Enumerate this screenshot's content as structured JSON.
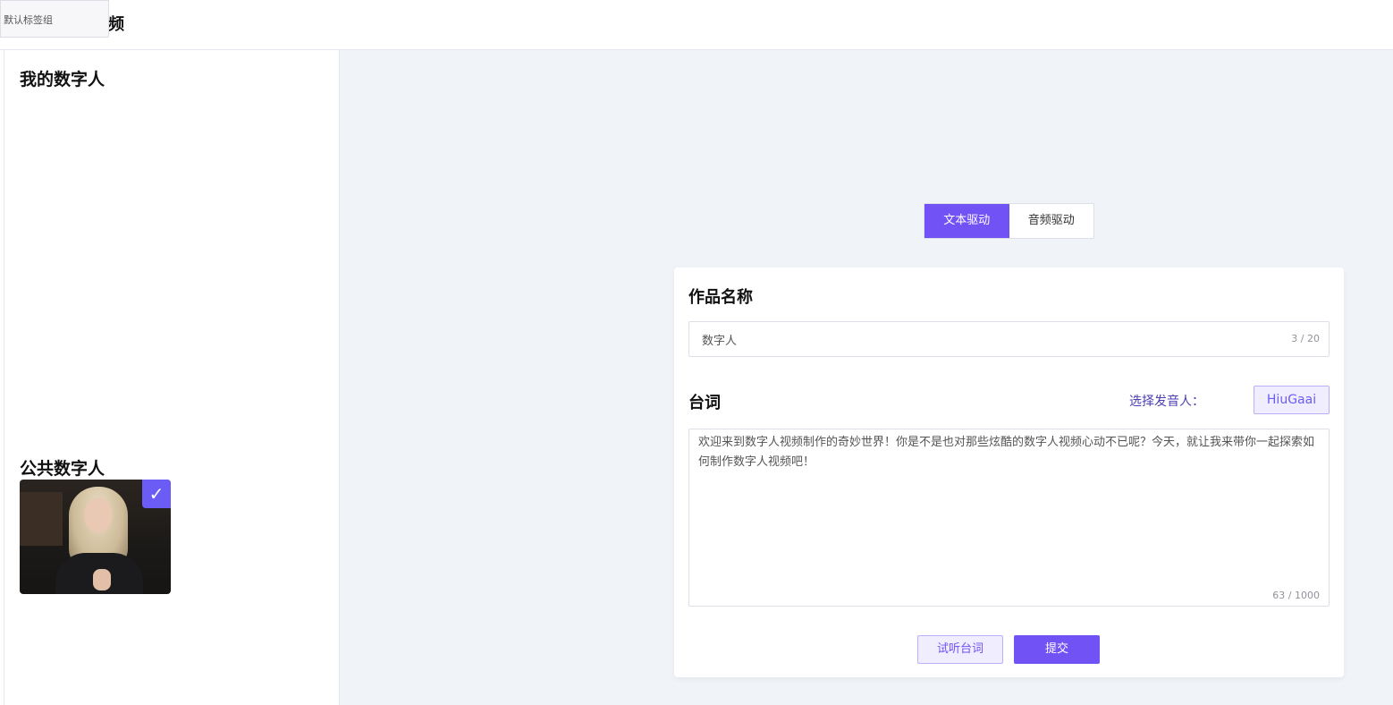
{
  "header": {
    "tab_group_label": "默认标签组",
    "title": "频"
  },
  "sidebar": {
    "my_avatars_title": "我的数字人",
    "public_avatars_title": "公共数字人",
    "public_avatars": [
      {
        "selected": true,
        "check_icon": "check-icon"
      }
    ]
  },
  "mode_switch": {
    "text_mode": "文本驱动",
    "audio_mode": "音频驱动",
    "active": "text_mode"
  },
  "form": {
    "name_label": "作品名称",
    "name_value": "数字人",
    "name_counter": "3 / 20",
    "script_label": "台词",
    "speaker_label": "选择发音人：",
    "speaker_value": "HiuGaai",
    "script_value": "欢迎来到数字人视频制作的奇妙世界！你是不是也对那些炫酷的数字人视频心动不已呢？今天，就让我来带你一起探索如何制作数字人视频吧！",
    "script_counter": "63 / 1000",
    "listen_button": "试听台词",
    "submit_button": "提交"
  },
  "colors": {
    "accent": "#7152f5",
    "accent_light": "#f0edfe",
    "background": "#f0f3f8"
  }
}
